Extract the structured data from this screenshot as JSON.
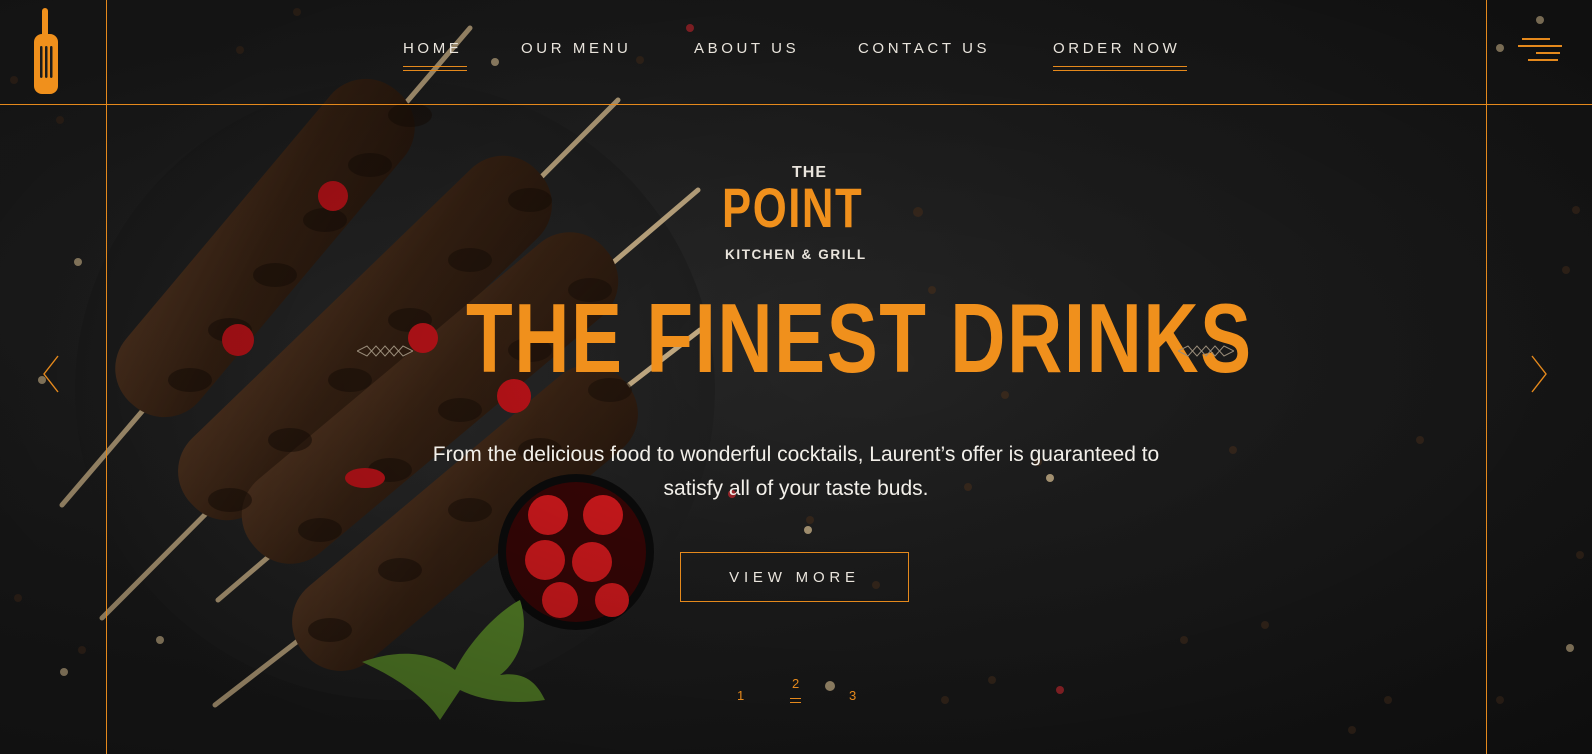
{
  "brand": {
    "the": "THE",
    "point": "POINT",
    "subtitle": "KITCHEN & GRILL"
  },
  "nav": {
    "items": [
      {
        "label": "HOME",
        "active": true
      },
      {
        "label": "OUR MENU"
      },
      {
        "label": "ABOUT US"
      },
      {
        "label": "CONTACT US"
      },
      {
        "label": "ORDER NOW",
        "highlighted": true
      }
    ]
  },
  "hero": {
    "headline": "THE FINEST DRINKS",
    "tagline": "From the delicious food to wonderful cocktails, Laurent’s offer is guaranteed to satisfy all of your taste buds.",
    "cta_label": "VIEW MORE"
  },
  "slider": {
    "pages": [
      "1",
      "2",
      "3"
    ],
    "active_page": "2"
  },
  "colors": {
    "accent": "#f0901c",
    "text": "#e9e4dc",
    "background": "#1c1c1c"
  },
  "icons": {
    "logo": "fork-icon",
    "menu": "hamburger-icon",
    "prev": "chevron-left-icon",
    "next": "chevron-right-icon"
  }
}
